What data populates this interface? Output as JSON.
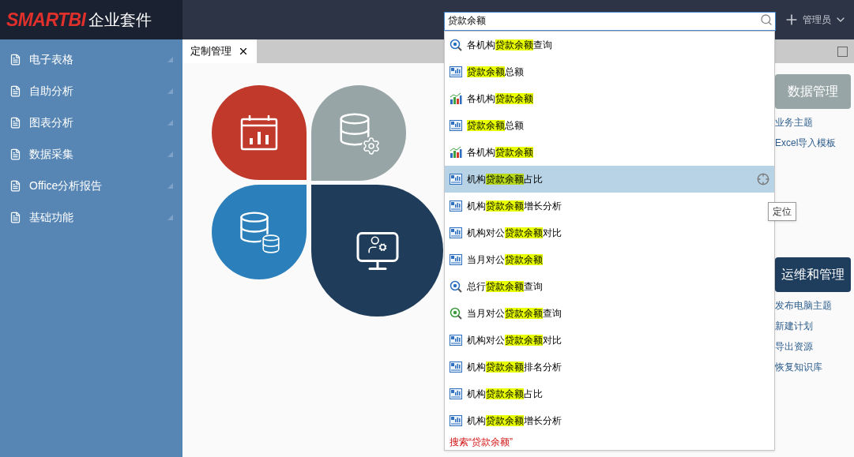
{
  "header": {
    "logo": "SMARTBI",
    "product": "企业套件",
    "search": {
      "value": "贷款余额"
    },
    "user": "管理员"
  },
  "sidebar": {
    "items": [
      {
        "label": "电子表格"
      },
      {
        "label": "自助分析"
      },
      {
        "label": "图表分析"
      },
      {
        "label": "数据采集"
      },
      {
        "label": "Office分析报告"
      },
      {
        "label": "基础功能"
      }
    ]
  },
  "tabs": [
    {
      "label": "定制管理",
      "selected": true
    }
  ],
  "cards": [
    {
      "title": "数据管理",
      "color": "#98a5a6",
      "links": [
        "业务主题",
        "Excel导入模板"
      ]
    },
    {
      "title": "运维和管理",
      "color": "#1f3d5c",
      "links": [
        "发布电脑主题",
        "新建计划",
        "导出资源",
        "恢复知识库"
      ]
    }
  ],
  "suggestions": {
    "items": [
      {
        "kind": "query",
        "before": "各机构",
        "match": "贷款余额",
        "after": "查询",
        "selected": false
      },
      {
        "kind": "report",
        "match": "贷款余额",
        "after": "总额",
        "selected": false
      },
      {
        "kind": "chart",
        "before": "各机构",
        "match": "贷款余额",
        "selected": false
      },
      {
        "kind": "report",
        "match": "贷款余额",
        "after": "总额",
        "selected": false
      },
      {
        "kind": "chart",
        "before": "各机构",
        "match": "贷款余额",
        "selected": false
      },
      {
        "kind": "report",
        "before": "机构",
        "match": "贷款余额",
        "after": "占比",
        "selected": true
      },
      {
        "kind": "report",
        "before": "机构",
        "match": "贷款余额",
        "after": "增长分析",
        "selected": false
      },
      {
        "kind": "report",
        "before": "机构对公",
        "match": "贷款余额",
        "after": "对比",
        "selected": false
      },
      {
        "kind": "report",
        "before": "当月对公",
        "match": "贷款余额",
        "selected": false
      },
      {
        "kind": "query",
        "before": "总行",
        "match": "贷款余额",
        "after": "查询",
        "selected": false
      },
      {
        "kind": "vquery",
        "before": "当月对公",
        "match": "贷款余额",
        "after": "查询",
        "selected": false
      },
      {
        "kind": "report",
        "before": "机构对公",
        "match": "贷款余额",
        "after": "对比",
        "selected": false
      },
      {
        "kind": "report",
        "before": "机构",
        "match": "贷款余额",
        "after": "排名分析",
        "selected": false
      },
      {
        "kind": "report",
        "before": "机构",
        "match": "贷款余额",
        "after": "占比",
        "selected": false
      },
      {
        "kind": "report",
        "before": "机构",
        "match": "贷款余额",
        "after": "增长分析",
        "selected": false
      }
    ],
    "search_all": "搜索“贷款余额”"
  },
  "tooltip": "定位"
}
